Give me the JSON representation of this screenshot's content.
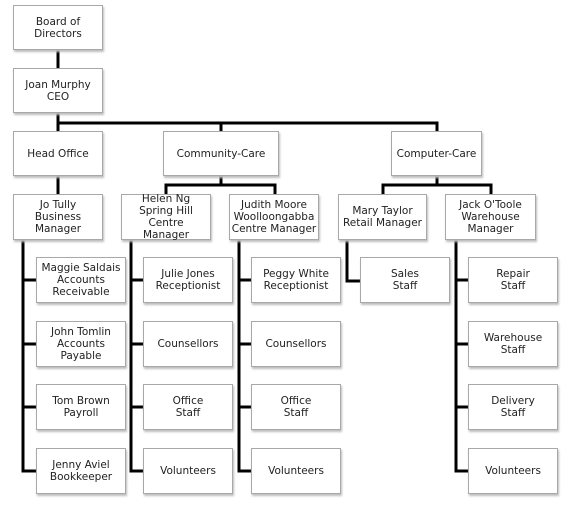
{
  "chart": {
    "line_color": "#000000",
    "nodes": {
      "board": "Board of\nDirectors",
      "ceo": "Joan Murphy\nCEO",
      "head_office": "Head Office",
      "community_care": "Community-Care",
      "computer_care": "Computer-Care",
      "jo_tully": "Jo Tully\nBusiness\nManager",
      "helen_ng": "Helen Ng\nSpring Hill Centre\nManager",
      "judith_moore": "Judith Moore\nWoolloongabba\nCentre Manager",
      "mary_taylor": "Mary Taylor\nRetail Manager",
      "jack_otoole": "Jack O'Toole\nWarehouse\nManager",
      "maggie": "Maggie Saldais\nAccounts\nReceivable",
      "john": "John Tomlin\nAccounts\nPayable",
      "tom": "Tom Brown\nPayroll",
      "jenny": "Jenny Aviel\nBookkeeper",
      "julie": "Julie Jones\nReceptionist",
      "counsellors_1": "Counsellors",
      "office_staff_1": "Office\nStaff",
      "volunteers_1": "Volunteers",
      "peggy": "Peggy White\nReceptionist",
      "counsellors_2": "Counsellors",
      "office_staff_2": "Office\nStaff",
      "volunteers_2": "Volunteers",
      "sales": "Sales\nStaff",
      "repair": "Repair\nStaff",
      "warehouse": "Warehouse\nStaff",
      "delivery": "Delivery\nStaff",
      "volunteers_3": "Volunteers"
    }
  }
}
